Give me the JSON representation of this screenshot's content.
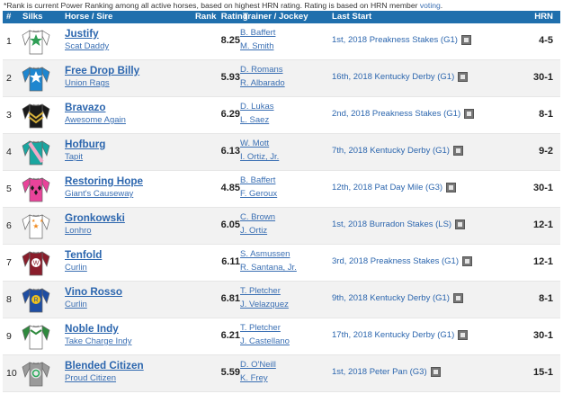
{
  "note": {
    "text": "*Rank is current Power Ranking among all active horses, based on highest HRN rating. Rating is based on HRN member ",
    "link": "voting",
    "end": "."
  },
  "header": {
    "num": "#",
    "silks": "Silks",
    "horse_sire": "Horse / Sire",
    "rank_rating": "Rank  Rating",
    "trainer_jockey": "Trainer / Jockey",
    "last_start": "Last Start",
    "hrn": "HRN"
  },
  "rows": [
    {
      "num": "1",
      "horse": "Justify",
      "sire": "Scat Daddy",
      "rating": "8.25",
      "trainer": "B. Baffert",
      "jockey": "M. Smith",
      "last_start": "1st, 2018 Preakness Stakes (G1)",
      "odds": "4-5",
      "silk_icon": "green-star-silk-icon",
      "colors": {
        "body": "#ffffff",
        "sleeve": "#ffffff",
        "accent": "#2f9e55"
      }
    },
    {
      "num": "2",
      "horse": "Free Drop Billy",
      "sire": "Union Rags",
      "rating": "5.93",
      "trainer": "D. Romans",
      "jockey": "R. Albarado",
      "last_start": "16th, 2018 Kentucky Derby (G1)",
      "odds": "30-1",
      "silk_icon": "blue-star-silk-icon",
      "colors": {
        "body": "#1e86cf",
        "sleeve": "#1e86cf",
        "accent": "#ffffff"
      }
    },
    {
      "num": "3",
      "horse": "Bravazo",
      "sire": "Awesome Again",
      "rating": "6.29",
      "trainer": "D. Lukas",
      "jockey": "L. Saez",
      "last_start": "2nd, 2018 Preakness Stakes (G1)",
      "odds": "8-1",
      "silk_icon": "black-chevron-silk-icon",
      "colors": {
        "body": "#1a1a1a",
        "sleeve": "#1a1a1a",
        "accent": "#d8b23a"
      }
    },
    {
      "num": "4",
      "horse": "Hofburg",
      "sire": "Tapit",
      "rating": "6.13",
      "trainer": "W. Mott",
      "jockey": "I. Ortiz, Jr.",
      "last_start": "7th, 2018 Kentucky Derby (G1)",
      "odds": "9-2",
      "silk_icon": "teal-sash-silk-icon",
      "colors": {
        "body": "#1aa6a0",
        "sleeve": "#1aa6a0",
        "accent": "#f2a9c6"
      }
    },
    {
      "num": "5",
      "horse": "Restoring Hope",
      "sire": "Giant's Causeway",
      "rating": "4.85",
      "trainer": "B. Baffert",
      "jockey": "F. Geroux",
      "last_start": "12th, 2018 Pat Day Mile (G3)",
      "odds": "30-1",
      "silk_icon": "pink-diamonds-silk-icon",
      "colors": {
        "body": "#e9439a",
        "sleeve": "#e9439a",
        "accent": "#1a1a1a"
      }
    },
    {
      "num": "6",
      "horse": "Gronkowski",
      "sire": "Lonhro",
      "rating": "6.05",
      "trainer": "C. Brown",
      "jockey": "J. Ortiz",
      "last_start": "1st, 2018 Burradon Stakes (LS)",
      "odds": "12-1",
      "silk_icon": "orange-stars-silk-icon",
      "colors": {
        "body": "#ffffff",
        "sleeve": "#ffffff",
        "accent": "#f08a1e"
      }
    },
    {
      "num": "7",
      "horse": "Tenfold",
      "sire": "Curlin",
      "rating": "6.11",
      "trainer": "S. Asmussen",
      "jockey": "R. Santana, Jr.",
      "last_start": "3rd, 2018 Preakness Stakes (G1)",
      "odds": "12-1",
      "silk_icon": "maroon-w-silk-icon",
      "colors": {
        "body": "#8a1d2b",
        "sleeve": "#8a1d2b",
        "accent": "#ffffff"
      }
    },
    {
      "num": "8",
      "horse": "Vino Rosso",
      "sire": "Curlin",
      "rating": "6.81",
      "trainer": "T. Pletcher",
      "jockey": "J. Velazquez",
      "last_start": "9th, 2018 Kentucky Derby (G1)",
      "odds": "8-1",
      "silk_icon": "blue-r-silk-icon",
      "colors": {
        "body": "#1f4ea3",
        "sleeve": "#1f4ea3",
        "accent": "#f1c21b"
      }
    },
    {
      "num": "9",
      "horse": "Noble Indy",
      "sire": "Take Charge Indy",
      "rating": "6.21",
      "trainer": "T. Pletcher",
      "jockey": "J. Castellano",
      "last_start": "17th, 2018 Kentucky Derby (G1)",
      "odds": "30-1",
      "silk_icon": "green-white-silk-icon",
      "colors": {
        "body": "#ffffff",
        "sleeve": "#2f8a3e",
        "accent": "#2f8a3e"
      }
    },
    {
      "num": "10",
      "horse": "Blended Citizen",
      "sire": "Proud Citizen",
      "rating": "5.59",
      "trainer": "D. O'Neill",
      "jockey": "K. Frey",
      "last_start": "1st, 2018 Peter Pan (G3)",
      "odds": "15-1",
      "silk_icon": "recycle-silk-icon",
      "colors": {
        "body": "#9a9a9a",
        "sleeve": "#9a9a9a",
        "accent": "#2aa85a"
      }
    }
  ]
}
